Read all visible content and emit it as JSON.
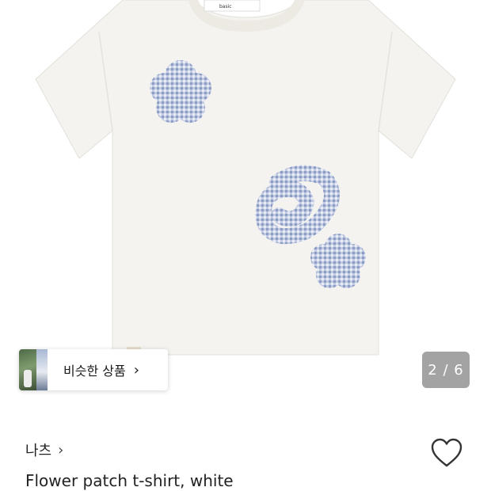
{
  "product_image": {
    "description_icon": "tshirt-image",
    "shirt_color": "#f4f3ef",
    "patch_color": "#a9b6d6",
    "collar_tag_text": "basic"
  },
  "similar_products": {
    "label": "비슷한 상품",
    "chevron": "›"
  },
  "image_counter": {
    "text": "2 / 6",
    "current": 2,
    "total": 6
  },
  "brand": {
    "name": "나츠",
    "chevron": "›"
  },
  "product": {
    "title": "Flower patch t-shirt, white"
  },
  "colors": {
    "counter_bg": "#808080",
    "heart_stroke": "#333333"
  }
}
